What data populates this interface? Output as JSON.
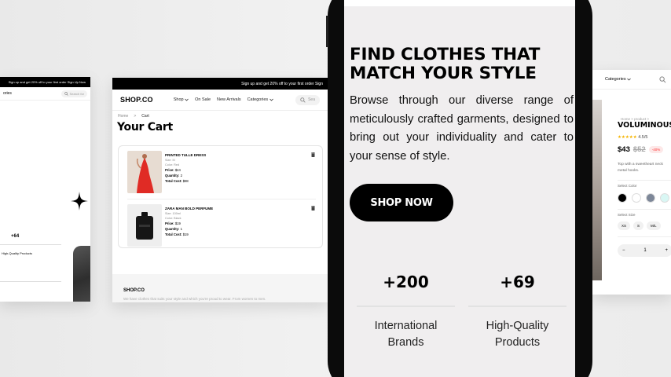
{
  "left_screen": {
    "announcement": "Sign up and get 20% off to your first order Sign Up Now",
    "menu_partial": "ories",
    "search_placeholder": "Search for",
    "stat_number": "+64",
    "stat_label": "High-Quality Products"
  },
  "cart_screen": {
    "announcement": "Sign up and get 20% off to your first order Sign",
    "logo": "SHOP.CO",
    "nav": {
      "shop": "Shop",
      "on_sale": "On Sale",
      "new_arrivals": "New Arrivals",
      "categories": "Categories",
      "search_placeholder": "Sea"
    },
    "breadcrumb": {
      "home": "Home",
      "separator": ">",
      "current": "Cart"
    },
    "title": "Your Cart",
    "items": [
      {
        "name": "PRINTED TULLE DRESS",
        "size": "Size: M",
        "color": "Color: Red",
        "price_label": "Price:",
        "price": "$44",
        "qty_label": "Quantity:",
        "qty": "2",
        "total_label": "Total Cost:",
        "total": "$88"
      },
      {
        "name": "ZARA MAN BOLD PERFUME",
        "size": "Size: 100ml",
        "color": "Color: Black",
        "price_label": "Price:",
        "price": "$19",
        "qty_label": "Quantity:",
        "qty": "1",
        "total_label": "Total Cost:",
        "total": "$19"
      }
    ],
    "footer": {
      "logo": "SHOP.CO",
      "text": "We have clothes that suits your style and which you're proud to wear. From women to men."
    }
  },
  "phone": {
    "headline": "FIND CLOTHES THAT MATCH YOUR STYLE",
    "description": "Browse through our diverse range of meticulously crafted garments, designed to bring out your individuality and cater to your sense of style.",
    "cta": "SHOP NOW",
    "stats": [
      {
        "number": "+200",
        "label": "International Brands"
      },
      {
        "number": "+69",
        "label": "High-Quality Products"
      }
    ]
  },
  "right_screen": {
    "nav_categories": "Categories",
    "breadcrumb": "Home  >  product  >",
    "product_name": "VOLUMINOUS",
    "stars": "★★★★★",
    "rating": "4.5/5",
    "price": "$43",
    "old_price": "$52",
    "discount": "-40%",
    "description_line1": "Top with a sweetheart neck",
    "description_line2": "metal hooks.",
    "select_color": "Select Color",
    "colors": [
      "#000000",
      "#ffffff",
      "#7d8798",
      "#d9f7f4"
    ],
    "select_size": "Select Size",
    "sizes": [
      "XS",
      "S",
      "M/L"
    ],
    "qty_minus": "−",
    "qty_value": "1",
    "qty_plus": "+"
  }
}
